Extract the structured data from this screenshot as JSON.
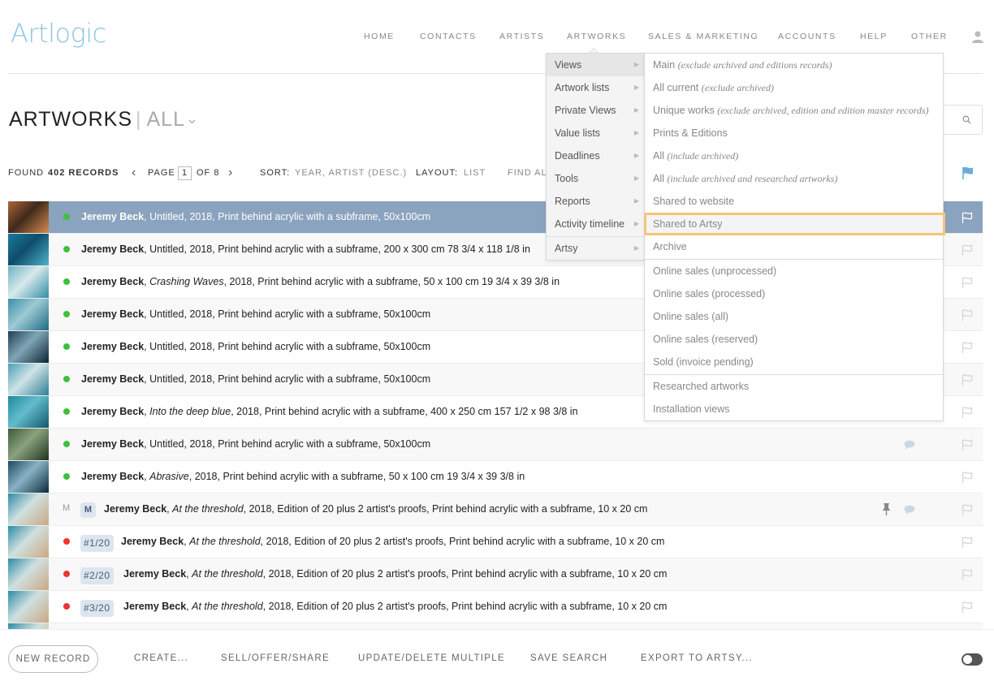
{
  "brand": {
    "logo_text": "Artlogic",
    "logo_color": "#8fc3e3"
  },
  "nav": {
    "items": [
      "HOME",
      "CONTACTS",
      "ARTISTS",
      "ARTWORKS",
      "SALES & MARKETING",
      "ACCOUNTS",
      "HELP",
      "OTHER"
    ],
    "user_icon": "user-icon"
  },
  "title": {
    "main": "ARTWORKS",
    "separator": "|",
    "sub": "ALL",
    "chevron": "⌄"
  },
  "toolbar": {
    "found_label": "FOUND",
    "found_count": "402 RECORDS",
    "page_label": "PAGE",
    "page_value": "1",
    "of_label": "OF 8",
    "sort_label": "SORT:",
    "sort_value": "YEAR, ARTIST (DESC.)",
    "layout_label": "LAYOUT:",
    "layout_value": "LIST",
    "find_label": "FIND AL"
  },
  "rows": [
    {
      "status": "green",
      "artist": "Jeremy Beck",
      "title": "Untitled",
      "italic": false,
      "rest": ", 2018, Print behind acrylic with a subframe, 50x100cm",
      "selected": true,
      "thumb": [
        "#b0653a",
        "#3f2a1c",
        "#d98b4e"
      ]
    },
    {
      "status": "green",
      "artist": "Jeremy Beck",
      "title": "Untitled",
      "italic": false,
      "rest": ", 2018, Print behind acrylic with a subframe, 200 x 300 cm 78 3/4 x 118 1/8 in",
      "thumb": [
        "#1a7a9c",
        "#0e4d6b",
        "#4fb3c9"
      ]
    },
    {
      "status": "green",
      "artist": "Jeremy Beck",
      "title": "Crashing Waves",
      "italic": true,
      "rest": ", 2018, Print behind acrylic with a subframe, 50 x 100 cm 19 3/4 x 39 3/8 in",
      "thumb": [
        "#6cb3c2",
        "#d8e9ec",
        "#2f8ea3"
      ]
    },
    {
      "status": "green",
      "artist": "Jeremy Beck",
      "title": "Untitled",
      "italic": false,
      "rest": ", 2018, Print behind acrylic with a subframe, 50x100cm",
      "thumb": [
        "#3b8fa8",
        "#9dcad3",
        "#1f6b83"
      ]
    },
    {
      "status": "green",
      "artist": "Jeremy Beck",
      "title": "Untitled",
      "italic": false,
      "rest": ", 2018, Print behind acrylic with a subframe, 50x100cm",
      "thumb": [
        "#1d3d52",
        "#7fa6b5",
        "#0d2433"
      ]
    },
    {
      "status": "green",
      "artist": "Jeremy Beck",
      "title": "Untitled",
      "italic": false,
      "rest": ", 2018, Print behind acrylic with a subframe, 50x100cm",
      "thumb": [
        "#4aa1b5",
        "#cfe3e7",
        "#2b7f95"
      ]
    },
    {
      "status": "green",
      "artist": "Jeremy Beck",
      "title": "Into the deep blue",
      "italic": true,
      "rest": ", 2018, Print behind acrylic with a subframe, 400 x 250 cm 157 1/2 x 98 3/8 in",
      "thumb": [
        "#1f8aa0",
        "#63bccb",
        "#10586b"
      ]
    },
    {
      "status": "green",
      "artist": "Jeremy Beck",
      "title": "Untitled",
      "italic": false,
      "rest": ", 2018, Print behind acrylic with a subframe, 50x100cm",
      "chat": true,
      "thumb": [
        "#3d5a3a",
        "#8aa27c",
        "#22321f"
      ]
    },
    {
      "status": "green",
      "artist": "Jeremy Beck",
      "title": "Abrasive",
      "italic": true,
      "rest": ", 2018, Print behind acrylic with a subframe, 50 x 100 cm 19 3/4 x 39 3/8 in",
      "thumb": [
        "#1c4660",
        "#87b3c4",
        "#0e2a3a"
      ]
    },
    {
      "status": "none",
      "mletter": "M",
      "badge": "M",
      "artist": "Jeremy Beck",
      "title": "At the threshold",
      "italic": true,
      "rest": ", 2018, Edition of 20 plus 2 artist's proofs, Print behind acrylic with a subframe, 10 x 20 cm",
      "chat": true,
      "pin": true,
      "thumb": [
        "#2c8ba6",
        "#cfe0df",
        "#caa884"
      ]
    },
    {
      "status": "red",
      "badge": "#1/20",
      "artist": "Jeremy Beck",
      "title": "At the threshold",
      "italic": true,
      "rest": ", 2018, Edition of 20 plus 2 artist's proofs, Print behind acrylic with a subframe, 10 x 20 cm",
      "thumb": [
        "#2c8ba6",
        "#cfe0df",
        "#caa884"
      ]
    },
    {
      "status": "red",
      "badge": "#2/20",
      "artist": "Jeremy Beck",
      "title": "At the threshold",
      "italic": true,
      "rest": ", 2018, Edition of 20 plus 2 artist's proofs, Print behind acrylic with a subframe, 10 x 20 cm",
      "thumb": [
        "#2c8ba6",
        "#cfe0df",
        "#caa884"
      ]
    },
    {
      "status": "red",
      "badge": "#3/20",
      "artist": "Jeremy Beck",
      "title": "At the threshold",
      "italic": true,
      "rest": ", 2018, Edition of 20 plus 2 artist's proofs, Print behind acrylic with a subframe, 10 x 20 cm",
      "thumb": [
        "#2c8ba6",
        "#cfe0df",
        "#caa884"
      ]
    },
    {
      "status": "none",
      "artist": "",
      "title": "",
      "italic": false,
      "rest": "",
      "thumb": [
        "#2c8ba6",
        "#cfe0df",
        "#caa884"
      ]
    }
  ],
  "menu_left": [
    {
      "label": "Views",
      "active": true
    },
    {
      "label": "Artwork lists"
    },
    {
      "label": "Private Views"
    },
    {
      "label": "Value lists"
    },
    {
      "label": "Deadlines"
    },
    {
      "label": "Tools"
    },
    {
      "label": "Reports"
    },
    {
      "label": "Activity timeline"
    },
    {
      "label": "Artsy",
      "divider_before": true
    }
  ],
  "menu_right": [
    {
      "label": "Main",
      "note": "(exclude archived and editions records)"
    },
    {
      "label": "All current",
      "note": "(exclude archived)"
    },
    {
      "label": "Unique works",
      "note": "(exclude archived, edition and edition master records)"
    },
    {
      "label": "Prints & Editions",
      "note": ""
    },
    {
      "label": "All",
      "note": "(include archived)"
    },
    {
      "label": "All",
      "note": "(include archived and researched artworks)"
    },
    {
      "label": "Shared to website",
      "note": ""
    },
    {
      "label": "Shared to Artsy",
      "note": "",
      "highlight": true
    },
    {
      "label": "Archive",
      "note": ""
    },
    {
      "label": "Online sales (unprocessed)",
      "note": "",
      "divider_before": true
    },
    {
      "label": "Online sales (processed)",
      "note": ""
    },
    {
      "label": "Online sales (all)",
      "note": ""
    },
    {
      "label": "Online sales (reserved)",
      "note": ""
    },
    {
      "label": "Sold (invoice pending)",
      "note": ""
    },
    {
      "label": "Researched artworks",
      "note": "",
      "divider_before": true
    },
    {
      "label": "Installation views",
      "note": ""
    }
  ],
  "footer": {
    "new_record": "NEW RECORD",
    "create": "CREATE...",
    "sell": "SELL/OFFER/SHARE",
    "update": "UPDATE/DELETE MULTIPLE",
    "save_search": "SAVE SEARCH",
    "export": "EXPORT TO ARTSY..."
  },
  "colors": {
    "selected_row": "#8aa3be",
    "highlight_border": "#f5c47a",
    "status_green": "#3fbf3f",
    "status_red": "#e33333",
    "flag_blue": "#6aabdc"
  }
}
